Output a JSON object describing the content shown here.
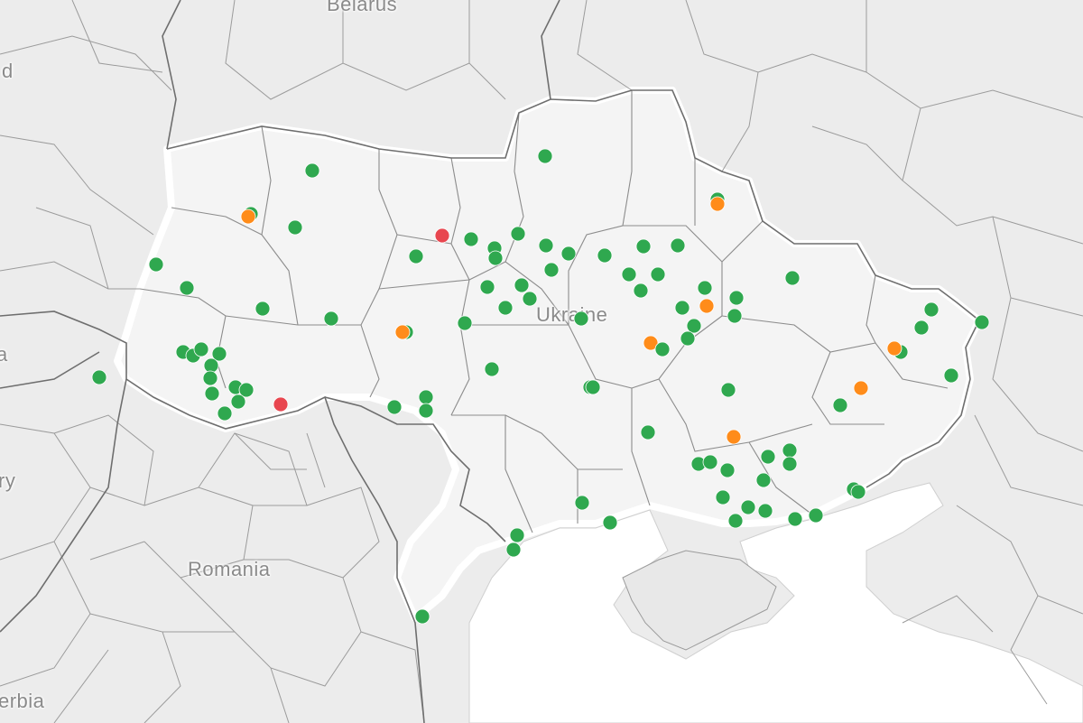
{
  "map": {
    "labels": {
      "belarus": "Belarus",
      "ukraine": "Ukraine",
      "romania": "Romania",
      "serbia": "erbia",
      "left_1": "d",
      "left_2": "ry",
      "left_3": "a"
    },
    "colors": {
      "land": "#ececec",
      "sea": "#ffffff",
      "border_minor": "#8c8c8c",
      "border_major": "#6e6e6e",
      "ok": "#2fa84f",
      "warning": "#ff8c1a",
      "critical": "#e8464f"
    },
    "marker_statuses": [
      "ok",
      "warning",
      "critical"
    ]
  }
}
